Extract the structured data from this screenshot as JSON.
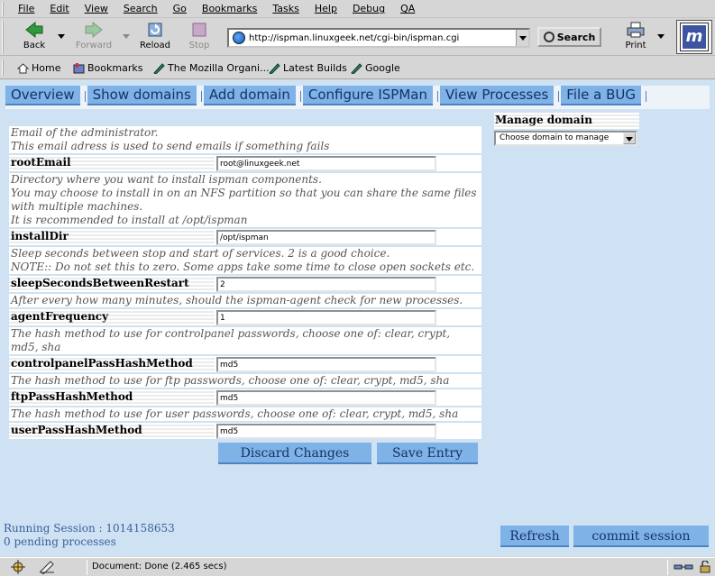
{
  "menubar": {
    "items": [
      "File",
      "Edit",
      "View",
      "Search",
      "Go",
      "Bookmarks",
      "Tasks",
      "Help",
      "Debug",
      "QA"
    ]
  },
  "navbar": {
    "back_label": "Back",
    "forward_label": "Forward",
    "reload_label": "Reload",
    "stop_label": "Stop",
    "url": "http://ispman.linuxgeek.net/cgi-bin/ispman.cgi",
    "search_label": "Search",
    "print_label": "Print"
  },
  "personal_toolbar": {
    "items": [
      "Home",
      "Bookmarks",
      "The Mozilla Organi...",
      "Latest Builds",
      "Google"
    ]
  },
  "tabs": [
    "Overview",
    "Show domains",
    "Add domain",
    "Configure ISPMan",
    "View Processes",
    "File a BUG"
  ],
  "form": {
    "fields": [
      {
        "desc": [
          "Email of the administrator.",
          "This email adress is used to send emails if something fails"
        ],
        "label": "rootEmail",
        "value": "root@linuxgeek.net"
      },
      {
        "desc": [
          "Directory where you want to install ispman components.",
          "You may choose to install in on an NFS partition so that you can share the same files with multiple machines.",
          "It is recommended to install at /opt/ispman"
        ],
        "label": "installDir",
        "value": "/opt/ispman"
      },
      {
        "desc": [
          "Sleep seconds between stop and start of services. 2 is a good choice.",
          "NOTE:: Do not set this to zero. Some apps take some time to close open sockets etc."
        ],
        "label": "sleepSecondsBetweenRestart",
        "value": "2"
      },
      {
        "desc": [
          "After every how many minutes, should the ispman-agent check for new processes."
        ],
        "label": "agentFrequency",
        "value": "1"
      },
      {
        "desc": [
          "The hash method to use for controlpanel passwords, choose one of: clear, crypt, md5, sha"
        ],
        "label": "controlpanelPassHashMethod",
        "value": "md5"
      },
      {
        "desc": [
          "The hash method to use for ftp passwords, choose one of: clear, crypt, md5, sha"
        ],
        "label": "ftpPassHashMethod",
        "value": "md5"
      },
      {
        "desc": [
          "The hash method to use for user passwords, choose one of: clear, crypt, md5, sha"
        ],
        "label": "userPassHashMethod",
        "value": "md5"
      }
    ],
    "discard_label": "Discard Changes",
    "save_label": "Save Entry"
  },
  "manage": {
    "title": "Manage domain",
    "select_value": "Choose domain to manage"
  },
  "session": {
    "running": "Running Session : 1014158653",
    "pending": "0 pending processes",
    "refresh_label": "Refresh",
    "commit_label": "commit session"
  },
  "status": {
    "text": "Document: Done (2.465 secs)"
  },
  "colors": {
    "content_bg": "#cfe2f3",
    "tab_bg": "#7fb2e6",
    "tab_text": "#14326b"
  }
}
